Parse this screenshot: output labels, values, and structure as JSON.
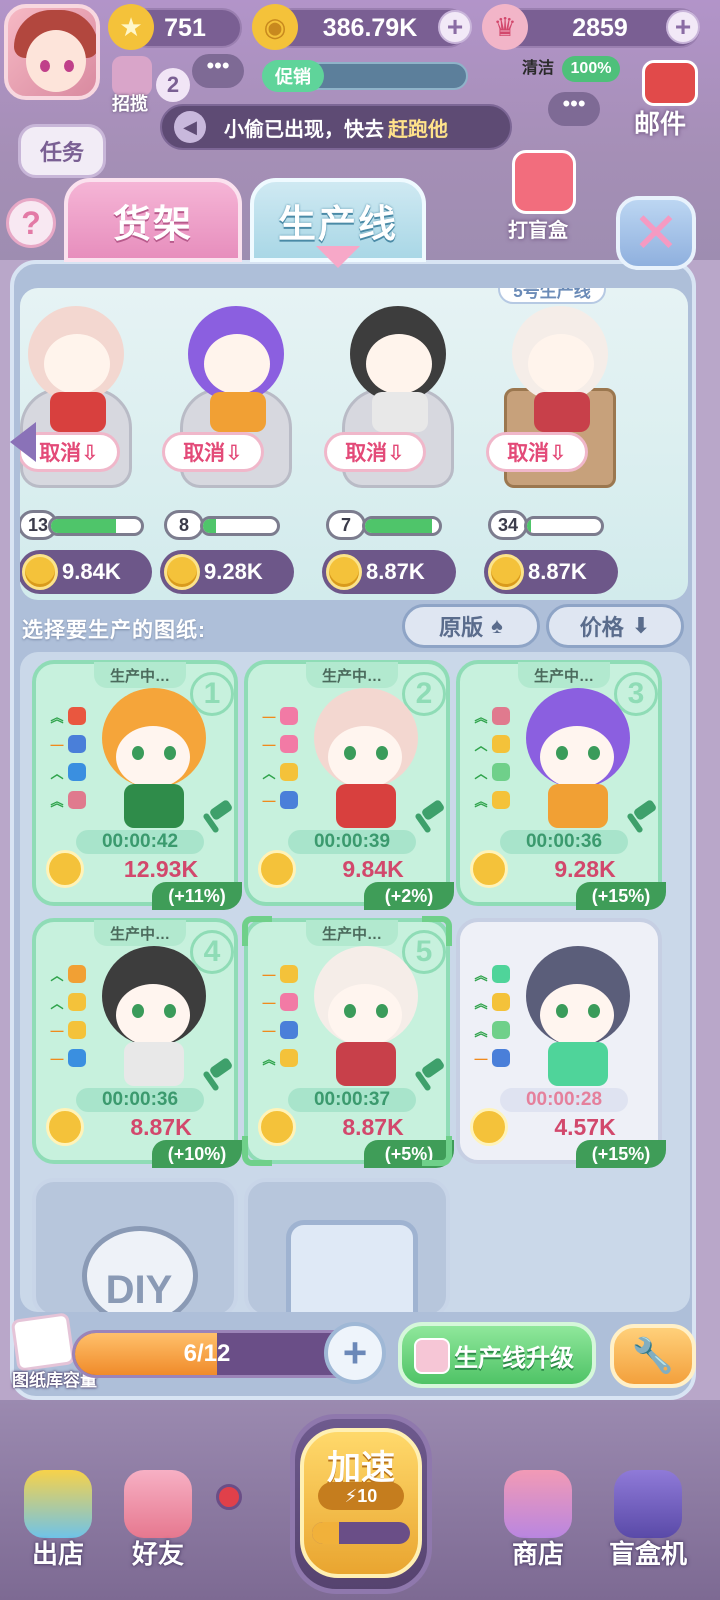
{
  "hud": {
    "stars": "751",
    "coins": "386.79K",
    "gems": "2859",
    "promo_label": "促销",
    "clean_label": "清洁",
    "clean_pct": "100%",
    "recruit_label": "招揽",
    "recruit_count": "2",
    "chat_dots": "•••",
    "notice_text": "小偷已出现，快去",
    "notice_highlight": "赶跑他",
    "mail_label": "邮件",
    "task_label": "任务",
    "blindbox_label": "打盲盒"
  },
  "tabs": {
    "shelf": "货架",
    "production_line": "生产线",
    "active": "production_line"
  },
  "production_lines": [
    {
      "count": "13",
      "progress": 0.72,
      "price": "9.84K",
      "cancel": "取消⇩",
      "hair": "#f3d7d0",
      "body": "#d8403e"
    },
    {
      "count": "8",
      "progress": 0.18,
      "price": "9.28K",
      "cancel": "取消⇩",
      "hair": "#8b5fe0",
      "body": "#f1a034"
    },
    {
      "count": "7",
      "progress": 0.9,
      "price": "8.87K",
      "cancel": "取消⇩",
      "hair": "#3d3d3d",
      "body": "#e8e8e8"
    },
    {
      "count": "34",
      "progress": 0.06,
      "price": "8.87K",
      "cancel": "取消⇩",
      "hair": "#f5ede8",
      "body": "#c8404a",
      "label": "5号生产线"
    }
  ],
  "select": {
    "label": "选择要生产的图纸:",
    "sort_original": "原版",
    "sort_price": "价格"
  },
  "blueprints": [
    {
      "status": "生产中…",
      "num": "1",
      "timer": "00:00:42",
      "price": "12.93K",
      "bonus": "(+11%)",
      "hair": "#f5a53a",
      "body": "#2f8c4a",
      "attrs": [
        {
          "a": "︽",
          "c": "#e9573f"
        },
        {
          "a": "—",
          "c": "#4a7fd9"
        },
        {
          "a": "︿",
          "c": "#3a8fe0"
        },
        {
          "a": "︽",
          "c": "#e07a8e"
        }
      ]
    },
    {
      "status": "生产中…",
      "num": "2",
      "timer": "00:00:39",
      "price": "9.84K",
      "bonus": "(+2%)",
      "hair": "#f3d7d0",
      "body": "#d8403e",
      "attrs": [
        {
          "a": "—",
          "c": "#f27aa5"
        },
        {
          "a": "—",
          "c": "#f27aa5"
        },
        {
          "a": "︿",
          "c": "#f4c23a"
        },
        {
          "a": "—",
          "c": "#4a7fd9"
        }
      ]
    },
    {
      "status": "生产中…",
      "num": "3",
      "timer": "00:00:36",
      "price": "9.28K",
      "bonus": "(+15%)",
      "hair": "#8b5fe0",
      "body": "#f1a034",
      "attrs": [
        {
          "a": "︽",
          "c": "#e07a8e"
        },
        {
          "a": "︿",
          "c": "#f4c23a"
        },
        {
          "a": "︿",
          "c": "#6fd08a"
        },
        {
          "a": "︽",
          "c": "#f4c23a"
        }
      ]
    },
    {
      "status": "生产中…",
      "num": "4",
      "timer": "00:00:36",
      "price": "8.87K",
      "bonus": "(+10%)",
      "hair": "#3d3d3d",
      "body": "#e8e8e8",
      "attrs": [
        {
          "a": "︿",
          "c": "#f1a034"
        },
        {
          "a": "︿",
          "c": "#f4c23a"
        },
        {
          "a": "—",
          "c": "#f4c23a"
        },
        {
          "a": "—",
          "c": "#3a8fe0"
        }
      ]
    },
    {
      "status": "生产中…",
      "num": "5",
      "timer": "00:00:37",
      "price": "8.87K",
      "bonus": "(+5%)",
      "hair": "#f5ede8",
      "body": "#c8404a",
      "attrs": [
        {
          "a": "—",
          "c": "#f4c23a"
        },
        {
          "a": "—",
          "c": "#f27aa5"
        },
        {
          "a": "—",
          "c": "#4a7fd9"
        },
        {
          "a": "︽",
          "c": "#f4c23a"
        }
      ]
    },
    {
      "status": "",
      "num": "",
      "timer": "00:00:28",
      "price": "4.57K",
      "bonus": "(+15%)",
      "hair": "#5b5e7a",
      "body": "#4fd49a",
      "attrs": [
        {
          "a": "︽",
          "c": "#4fd49a"
        },
        {
          "a": "︽",
          "c": "#f4c23a"
        },
        {
          "a": "︽",
          "c": "#6fd08a"
        },
        {
          "a": "—",
          "c": "#4a7fd9"
        }
      ]
    }
  ],
  "extra_slots": {
    "diy_label": "DIY"
  },
  "footer": {
    "library_label": "图纸库容量",
    "capacity_text": "6/12",
    "capacity_fill": 0.5,
    "upgrade_label": "生产线升级"
  },
  "nav": {
    "speed_label": "加速",
    "speed_count": "10",
    "items": {
      "store_out": "出店",
      "friends": "好友",
      "shop": "商店",
      "blindbox_machine": "盲盒机"
    }
  },
  "colors": {
    "accent_green": "#4fc366",
    "accent_pink": "#e34a78",
    "panel_blue": "#aebfd9"
  }
}
